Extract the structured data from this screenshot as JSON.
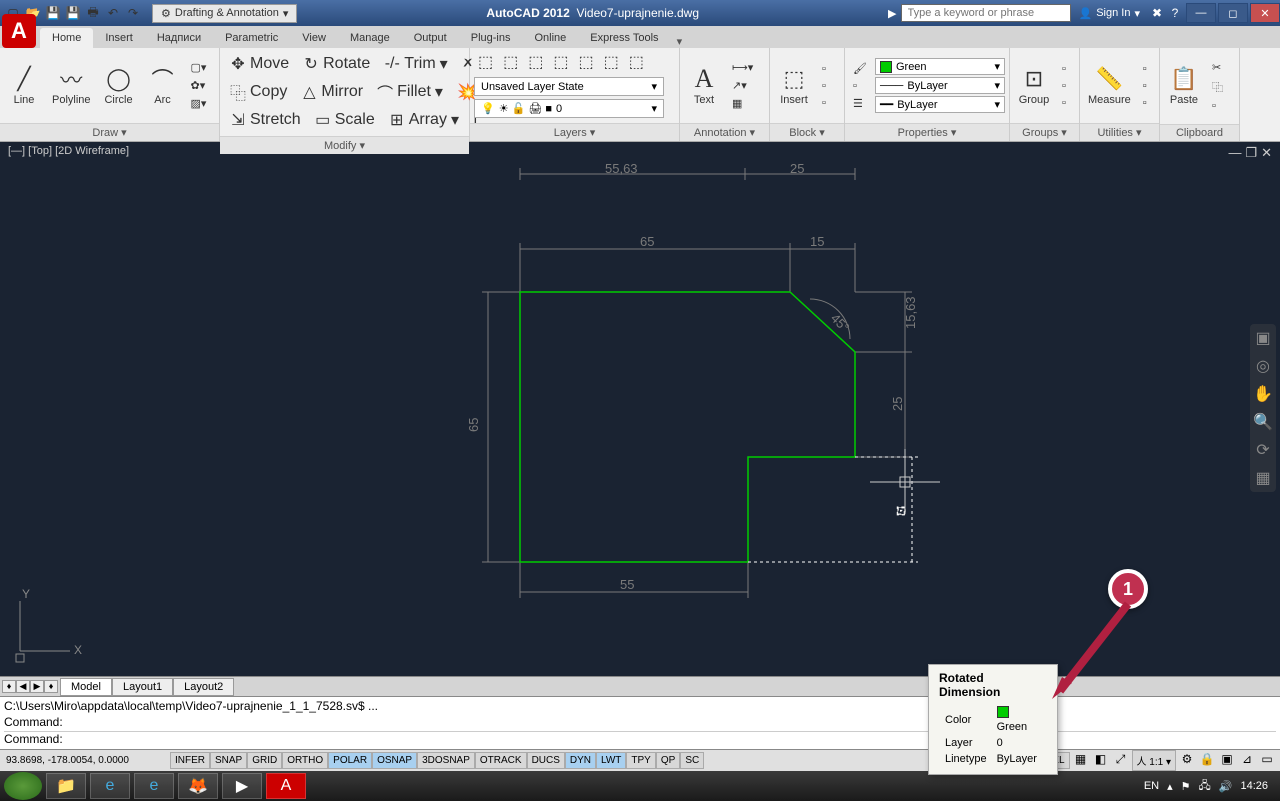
{
  "app": {
    "title": "AutoCAD 2012",
    "filename": "Video7-uprajnenie.dwg",
    "workspace": "Drafting & Annotation",
    "search_placeholder": "Type a keyword or phrase",
    "signin": "Sign In"
  },
  "tabs": [
    "Home",
    "Insert",
    "Надписи",
    "Parametric",
    "View",
    "Manage",
    "Output",
    "Plug-ins",
    "Online",
    "Express Tools"
  ],
  "active_tab": "Home",
  "ribbon": {
    "draw": {
      "title": "Draw ▾",
      "items": [
        "Line",
        "Polyline",
        "Circle",
        "Arc"
      ]
    },
    "modify": {
      "title": "Modify ▾",
      "rows": [
        {
          "icon": "✥",
          "label": "Move"
        },
        {
          "icon": "↻",
          "label": "Rotate"
        },
        {
          "icon": "-/-",
          "label": "Trim"
        },
        {
          "icon": "⿻",
          "label": "Copy"
        },
        {
          "icon": "△",
          "label": "Mirror"
        },
        {
          "icon": "⌒",
          "label": "Fillet"
        },
        {
          "icon": "⇲",
          "label": "Stretch"
        },
        {
          "icon": "▭",
          "label": "Scale"
        },
        {
          "icon": "⊞",
          "label": "Array"
        }
      ]
    },
    "layers": {
      "title": "Layers ▾",
      "state": "Unsaved Layer State",
      "current": "0"
    },
    "annotation": {
      "title": "Annotation ▾",
      "text": "Text"
    },
    "block": {
      "title": "Block ▾",
      "insert": "Insert"
    },
    "properties": {
      "title": "Properties ▾",
      "color": "Green",
      "line": "ByLayer",
      "lw": "ByLayer"
    },
    "groups": {
      "title": "Groups ▾",
      "label": "Group"
    },
    "utilities": {
      "title": "Utilities ▾",
      "label": "Measure"
    },
    "clipboard": {
      "title": "Clipboard",
      "label": "Paste"
    }
  },
  "viewport": {
    "label": "[—] [Top] [2D Wireframe]"
  },
  "dims": {
    "top1": "55,63",
    "top2": "25",
    "d65_top": "65",
    "d15": "15",
    "d15_63": "15,63",
    "d25": "25",
    "d65_left": "65",
    "d55": "55",
    "angle": "45°"
  },
  "tooltip": {
    "title": "Rotated Dimension",
    "color_label": "Color",
    "color_value": "Green",
    "layer_label": "Layer",
    "layer_value": "0",
    "ltype_label": "Linetype",
    "ltype_value": "ByLayer"
  },
  "callout": "1",
  "layout_tabs": [
    "Model",
    "Layout1",
    "Layout2"
  ],
  "cmd": {
    "line1": "C:\\Users\\Miro\\appdata\\local\\temp\\Video7-uprajnenie_1_1_7528.sv$  ...",
    "line2": "Command:",
    "line3": "Command:"
  },
  "status": {
    "coords": "93.8698, -178.0054, 0.0000",
    "toggles": [
      "INFER",
      "SNAP",
      "GRID",
      "ORTHO",
      "POLAR",
      "OSNAP",
      "3DOSNAP",
      "OTRACK",
      "DUCS",
      "DYN",
      "LWT",
      "TPY",
      "QP",
      "SC"
    ],
    "on": [
      "POLAR",
      "OSNAP",
      "DYN",
      "LWT"
    ],
    "model": "MODEL",
    "scale": "1:1"
  },
  "taskbar": {
    "lang": "EN",
    "time": "14:26"
  }
}
